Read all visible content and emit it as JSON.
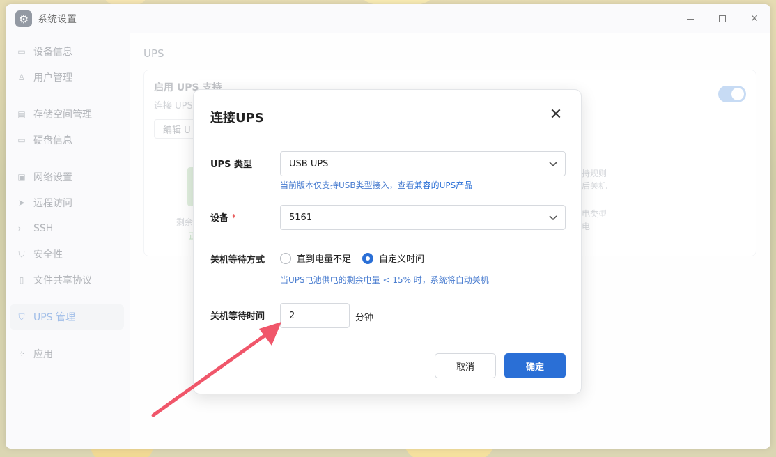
{
  "window": {
    "title": "系统设置"
  },
  "sidebar": {
    "items": [
      {
        "label": "设备信息",
        "icon": "device-icon"
      },
      {
        "label": "用户管理",
        "icon": "user-icon"
      },
      {
        "label": "存储空间管理",
        "icon": "storage-icon"
      },
      {
        "label": "硬盘信息",
        "icon": "disk-icon"
      },
      {
        "label": "网络设置",
        "icon": "network-icon"
      },
      {
        "label": "远程访问",
        "icon": "send-icon"
      },
      {
        "label": "SSH",
        "icon": "terminal-icon"
      },
      {
        "label": "安全性",
        "icon": "shield-icon"
      },
      {
        "label": "文件共享协议",
        "icon": "file-icon"
      },
      {
        "label": "UPS 管理",
        "icon": "shield-icon"
      },
      {
        "label": "应用",
        "icon": "apps-icon"
      }
    ],
    "active": "UPS 管理"
  },
  "main": {
    "title": "UPS",
    "card": {
      "title": "启用 UPS 支持",
      "subtitle": "连接 UPS",
      "edit_label": "编辑 U",
      "fragments": [
        "剩余",
        "正",
        "持规则",
        "后关机",
        "电类型",
        "电"
      ]
    }
  },
  "dialog": {
    "title": "连接UPS",
    "ups_type": {
      "label": "UPS 类型",
      "value": "USB UPS",
      "hint_prefix": "当前版本仅支持USB类型接入，查看",
      "hint_link": "兼容的UPS产品"
    },
    "device": {
      "label": "设备",
      "required_mark": "*",
      "value": "5161"
    },
    "shutdown_mode": {
      "label": "关机等待方式",
      "options": [
        "直到电量不足",
        "自定义时间"
      ],
      "selected": "自定义时间",
      "hint": "当UPS电池供电的剩余电量 < 15% 时，系统将自动关机"
    },
    "shutdown_time": {
      "label": "关机等待时间",
      "value": "2",
      "unit": "分钟"
    },
    "cancel_label": "取消",
    "ok_label": "确定"
  },
  "colors": {
    "accent": "#2a6fd6",
    "annotation_arrow": "#f0566a"
  }
}
